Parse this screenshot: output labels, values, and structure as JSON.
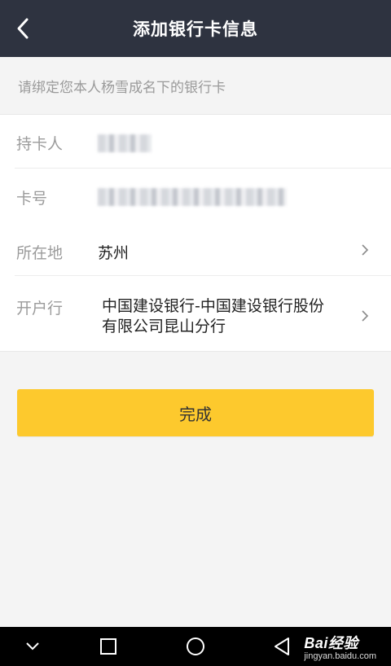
{
  "header": {
    "title": "添加银行卡信息",
    "back_icon": "chevron-left-icon"
  },
  "notice": "请绑定您本人杨雪成名下的银行卡",
  "form": {
    "cardholder": {
      "label": "持卡人",
      "value_masked": true
    },
    "card_number": {
      "label": "卡号",
      "value_masked": true
    },
    "location": {
      "label": "所在地",
      "value": "苏州"
    },
    "bank": {
      "label": "开户行",
      "value_line1": "中国建设银行-中国建设银行股份",
      "value_line2": "有限公司昆山分行"
    }
  },
  "done_button": {
    "label": "完成",
    "color": "#fdc92d"
  },
  "navbar": {
    "items": [
      "chevron-down-icon",
      "square-icon",
      "circle-icon",
      "triangle-back-icon"
    ]
  },
  "watermark": {
    "main": "Bai经验",
    "sub": "jingyan.baidu.com"
  },
  "colors": {
    "header_bg": "#2e3340",
    "page_bg": "#f4f4f4",
    "accent": "#fdc92d"
  }
}
